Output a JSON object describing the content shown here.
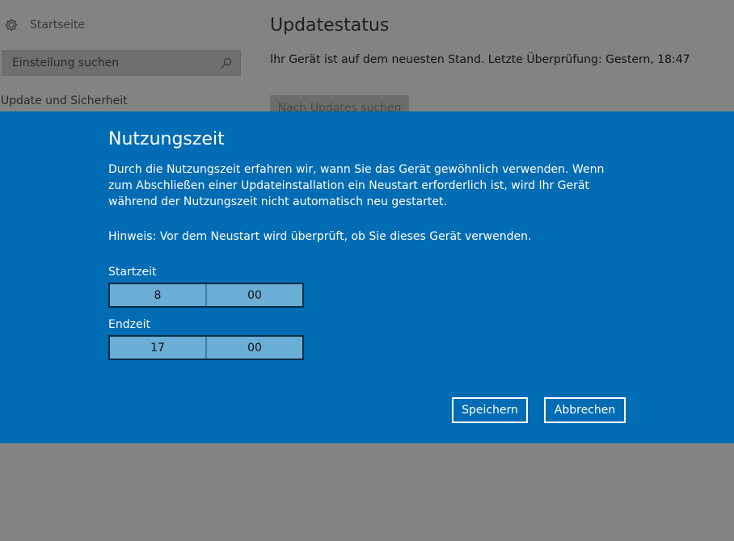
{
  "sidebar": {
    "home_label": "Startseite",
    "home_icon": "gear-icon",
    "search_placeholder": "Einstellung suchen",
    "search_icon": "search-icon",
    "section_title": "Update und Sicherheit"
  },
  "main": {
    "title": "Updatestatus",
    "status_text": "Ihr Gerät ist auf dem neuesten Stand. Letzte Überprüfung: Gestern, 18:47",
    "check_button_label": "Nach Updates suchen"
  },
  "dialog": {
    "title": "Nutzungszeit",
    "description": "Durch die Nutzungszeit erfahren wir, wann Sie das Gerät gewöhnlich verwenden. Wenn zum Abschließen einer Updateinstallation ein Neustart erforderlich ist, wird Ihr Gerät während der Nutzungszeit nicht automatisch neu gestartet.",
    "hint": "Hinweis: Vor dem Neustart wird überprüft, ob Sie dieses Gerät verwenden.",
    "start": {
      "label": "Startzeit",
      "hour": "8",
      "minute": "00"
    },
    "end": {
      "label": "Endzeit",
      "hour": "17",
      "minute": "00"
    },
    "save_label": "Speichern",
    "cancel_label": "Abbrechen",
    "colors": {
      "accent": "#006cb4",
      "picker_fill": "#6aadd5"
    }
  }
}
